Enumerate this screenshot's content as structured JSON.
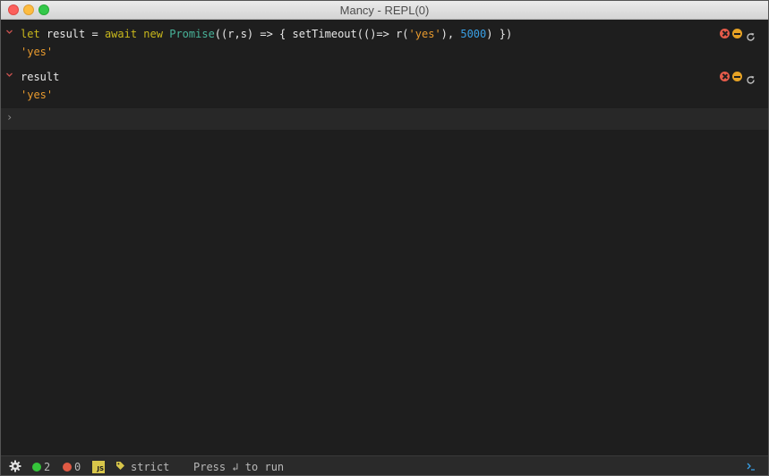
{
  "window": {
    "title": "Mancy - REPL(0)"
  },
  "entries": [
    {
      "code_tokens": [
        {
          "t": "let",
          "k": "kw"
        },
        {
          "t": " result = ",
          "k": "var"
        },
        {
          "t": "await",
          "k": "kw"
        },
        {
          "t": " ",
          "k": "var"
        },
        {
          "t": "new",
          "k": "kw"
        },
        {
          "t": " ",
          "k": "var"
        },
        {
          "t": "Promise",
          "k": "cls"
        },
        {
          "t": "((r,s) => { setTimeout(()=> r(",
          "k": "var"
        },
        {
          "t": "'yes'",
          "k": "str"
        },
        {
          "t": "), ",
          "k": "var"
        },
        {
          "t": "5000",
          "k": "num"
        },
        {
          "t": ") })",
          "k": "var"
        }
      ],
      "result": "'yes'"
    },
    {
      "code_tokens": [
        {
          "t": "result",
          "k": "var"
        }
      ],
      "result": "'yes'"
    }
  ],
  "prompt": {
    "chevron": "›",
    "value": ""
  },
  "statusbar": {
    "ok_count": "2",
    "error_count": "0",
    "lang_badge": "JS",
    "mode_label": "strict",
    "run_hint": "Press ↲ to run",
    "colors": {
      "ok": "#35c43a",
      "error": "#e05a44",
      "badge": "#d8c64a"
    }
  },
  "icons": {
    "settings": "gear-icon",
    "tag": "tag-icon",
    "terminal": "terminal-icon",
    "entry_delete": "close-circle-icon",
    "entry_fold": "minus-circle-icon",
    "entry_rerun": "reload-icon"
  }
}
